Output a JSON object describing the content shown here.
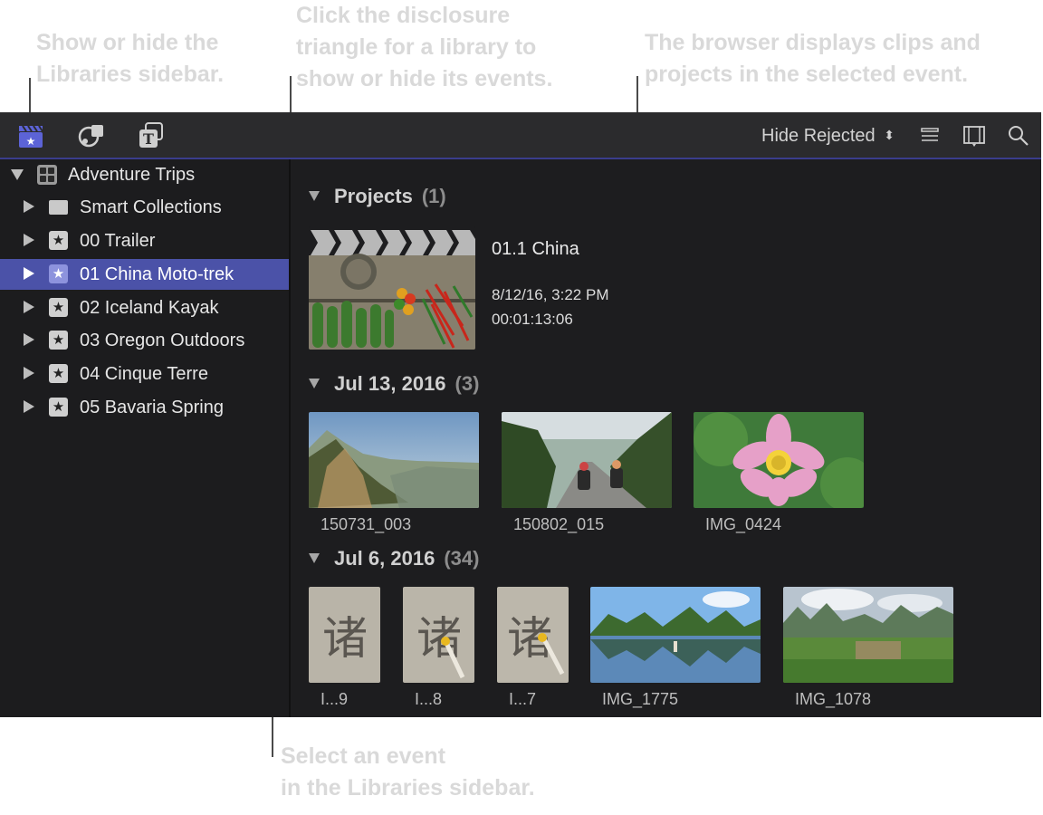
{
  "callouts": {
    "sidebar_toggle": "Show or hide the\nLibraries sidebar.",
    "disclosure": "Click the disclosure\ntriangle for a library to\nshow or hide its events.",
    "browser": "The browser displays clips and\nprojects in the selected event.",
    "select_event": "Select an event\nin the Libraries sidebar."
  },
  "toolbar": {
    "icons": [
      "libraries-clapper-icon",
      "photos-audio-icon",
      "titles-generators-icon"
    ],
    "filter_label": "Hide Rejected",
    "right_icons": [
      "list-view-icon",
      "filmstrip-view-icon",
      "search-icon"
    ],
    "accent": "#5c63d6"
  },
  "sidebar": {
    "library": "Adventure Trips",
    "items": [
      {
        "label": "Smart Collections",
        "icon": "folder-icon"
      },
      {
        "label": "00 Trailer",
        "icon": "star-icon"
      },
      {
        "label": "01 China Moto-trek",
        "icon": "star-icon",
        "selected": true
      },
      {
        "label": "02 Iceland Kayak",
        "icon": "star-icon"
      },
      {
        "label": "03 Oregon Outdoors",
        "icon": "star-icon"
      },
      {
        "label": "04 Cinque Terre",
        "icon": "star-icon"
      },
      {
        "label": "05 Bavaria Spring",
        "icon": "star-icon"
      }
    ],
    "selection_color": "#4b52a8"
  },
  "browser": {
    "sections": [
      {
        "title": "Projects",
        "count": "(1)"
      },
      {
        "title": "Jul 13, 2016",
        "count": "(3)"
      },
      {
        "title": "Jul 6, 2016",
        "count": "(34)"
      }
    ],
    "project": {
      "name": "01.1 China",
      "date": "8/12/16, 3:22 PM",
      "duration": "00:01:13:06"
    },
    "jul13": [
      "150731_003",
      "150802_015",
      "IMG_0424"
    ],
    "jul6": [
      "I...9",
      "I...8",
      "I...7",
      "IMG_1775",
      "IMG_1078"
    ]
  }
}
